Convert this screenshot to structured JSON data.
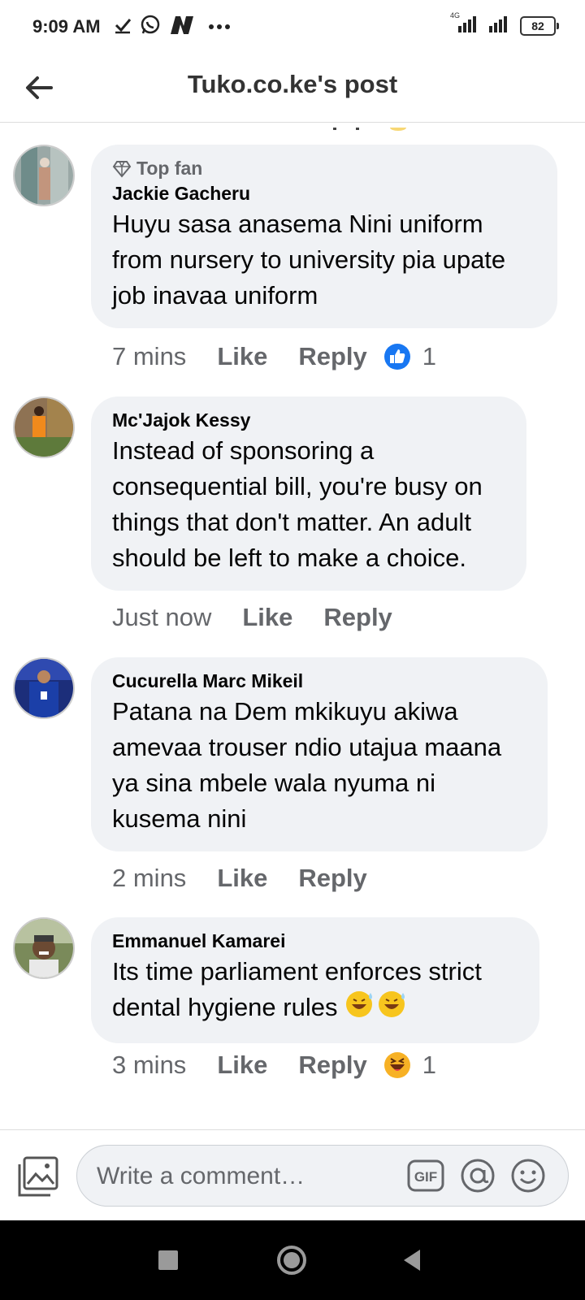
{
  "status_bar": {
    "time": "9:09 AM",
    "network_label": "4G",
    "battery": "82",
    "icons": [
      "check-icon",
      "whatsapp-icon",
      "n-app-icon",
      "more-dots-icon",
      "signal-icon",
      "signal-icon",
      "battery-icon"
    ]
  },
  "header": {
    "title": "Tuko.co.ke's post",
    "back_icon": "arrow-left-icon"
  },
  "comments": [
    {
      "badge": "Top fan",
      "author": "Jackie Gacheru",
      "text": "Huyu sasa anasema Nini uniform from nursery to university pia upate job inavaa uniform",
      "time": "7 mins",
      "like": "Like",
      "reply": "Reply",
      "reaction": "like",
      "reaction_count": "1"
    },
    {
      "author": "Mc'Jajok Kessy",
      "text": "Instead of sponsoring a consequential bill, you're busy on things that don't matter. An adult should be left to make a choice.",
      "time": "Just now",
      "like": "Like",
      "reply": "Reply"
    },
    {
      "author": "Cucurella Marc Mikeil",
      "text": "Patana na Dem mkikuyu akiwa amevaa trouser ndio utajua maana ya sina mbele wala nyuma ni kusema nini",
      "time": "2 mins",
      "like": "Like",
      "reply": "Reply"
    },
    {
      "author": "Emmanuel Kamarei",
      "text": "Its time parliament enforces strict dental hygiene rules",
      "text_emoji": "😅😅",
      "time": "3 mins",
      "like": "Like",
      "reply": "Reply",
      "reaction": "haha",
      "reaction_count": "1"
    }
  ],
  "composer": {
    "placeholder": "Write a comment…",
    "gif_label": "GIF"
  },
  "colors": {
    "bubble": "#f0f2f5",
    "secondary_text": "#65676b",
    "like_blue": "#1877f2",
    "haha_yellow": "#f7b125"
  }
}
